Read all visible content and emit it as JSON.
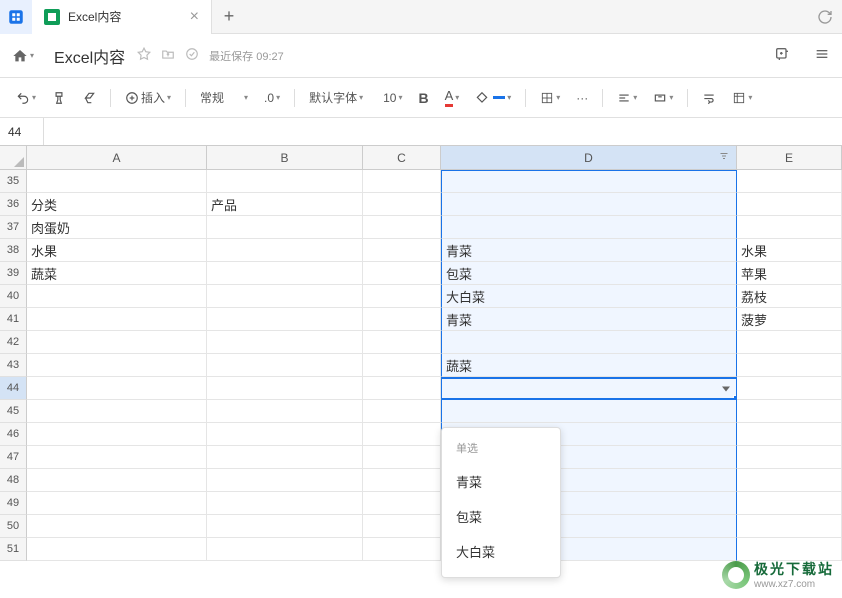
{
  "tab": {
    "title": "Excel内容",
    "close": "×",
    "add": "+"
  },
  "titlebar": {
    "doc_title": "Excel内容",
    "save_text": "最近保存 09:27"
  },
  "toolbar": {
    "insert": "插入",
    "format": "常规",
    "decimal": ".0",
    "font": "默认字体",
    "font_size": "10",
    "bold": "B",
    "font_color": "A",
    "more": "···"
  },
  "formula": {
    "cell_ref": "44"
  },
  "columns": [
    "A",
    "B",
    "C",
    "D",
    "E"
  ],
  "rows": [
    "35",
    "36",
    "37",
    "38",
    "39",
    "40",
    "41",
    "42",
    "43",
    "44",
    "45",
    "46",
    "47",
    "48",
    "49",
    "50",
    "51"
  ],
  "cells": {
    "A36": "分类",
    "B36": "产品",
    "A37": "肉蛋奶",
    "A38": "水果",
    "A39": "蔬菜",
    "D38": "青菜",
    "D39": "包菜",
    "D40": "大白菜",
    "D41": "青菜",
    "D43": "蔬菜",
    "E38": "水果",
    "E39": "苹果",
    "E40": "荔枝",
    "E41": "菠萝"
  },
  "dropdown": {
    "label": "单选",
    "items": [
      "青菜",
      "包菜",
      "大白菜"
    ]
  },
  "watermark": {
    "cn": "极光下载站",
    "url": "www.xz7.com"
  }
}
